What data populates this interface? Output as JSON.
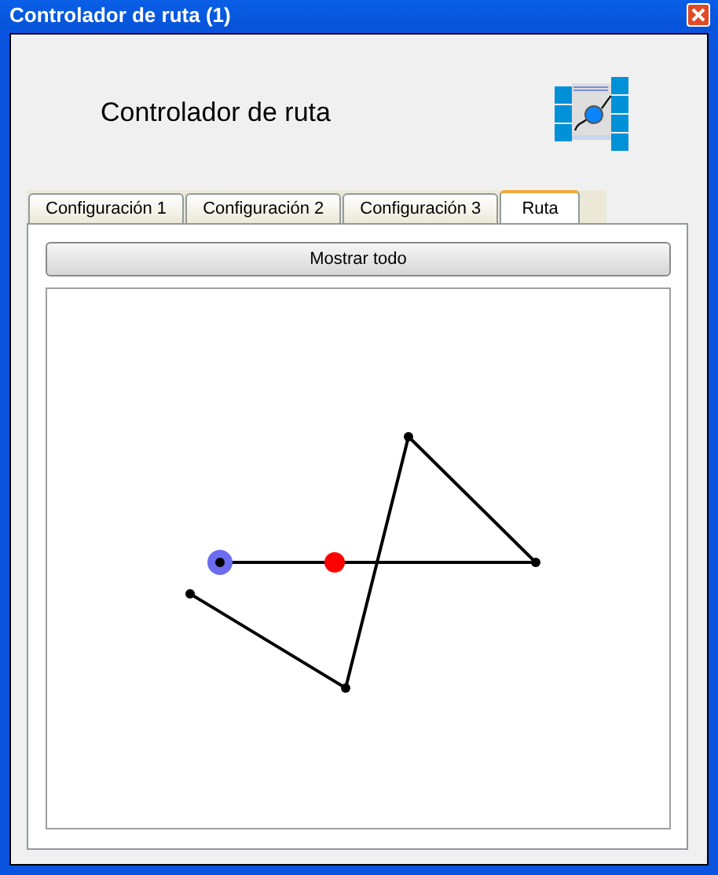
{
  "window": {
    "title": "Controlador de ruta (1)"
  },
  "header": {
    "title": "Controlador de ruta"
  },
  "tabs": [
    {
      "label": "Configuración 1",
      "selected": false
    },
    {
      "label": "Configuración 2",
      "selected": false
    },
    {
      "label": "Configuración 3",
      "selected": false
    },
    {
      "label": "Ruta",
      "selected": true
    }
  ],
  "show_all_button": {
    "label": "Mostrar todo"
  }
}
